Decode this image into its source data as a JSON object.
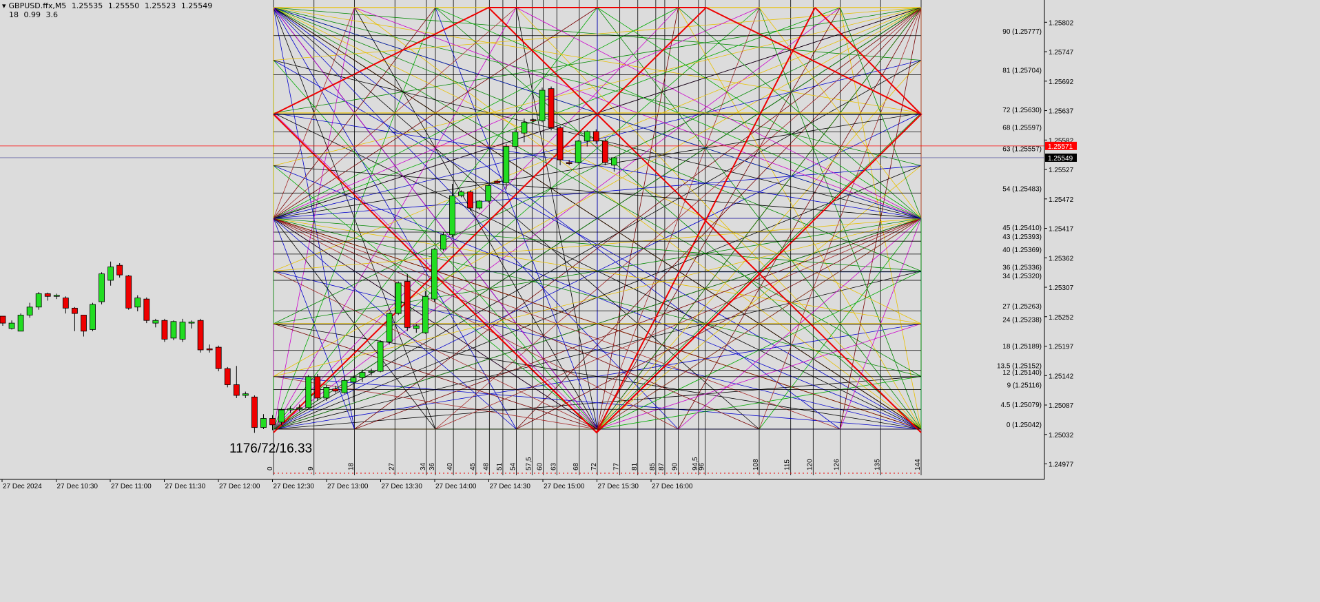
{
  "header": {
    "symbol": "GBPUSD.ffx,M5",
    "open": "1.25535",
    "high": "1.25550",
    "low": "1.25523",
    "close": "1.25549",
    "ind1": "18",
    "ind2": "0.99",
    "ind3": "3.6"
  },
  "annotation": "1176/72/16.33",
  "chart_data": {
    "type": "candlestick",
    "symbol": "GBPUSD.ffx",
    "timeframe": "M5",
    "grid": true,
    "ylim": [
      1.2495,
      1.2585
    ],
    "y_ticks": [
      "1.25802",
      "1.25747",
      "1.25692",
      "1.25637",
      "1.25582",
      "1.25527",
      "1.25472",
      "1.25417",
      "1.25362",
      "1.25307",
      "1.25252",
      "1.25197",
      "1.25142",
      "1.25087",
      "1.25032",
      "1.24977"
    ],
    "x_ticks": [
      "27 Dec 2024",
      "27 Dec 10:30",
      "27 Dec 11:00",
      "27 Dec 11:30",
      "27 Dec 12:00",
      "27 Dec 12:30",
      "27 Dec 13:00",
      "27 Dec 13:30",
      "27 Dec 14:00",
      "27 Dec 14:30",
      "27 Dec 15:00",
      "27 Dec 15:30",
      "27 Dec 16:00"
    ],
    "price_labels": {
      "bid": "1.25571",
      "ask": "1.25549",
      "bid_color": "#ff0000",
      "ask_color": "#000000"
    },
    "levels": [
      {
        "label": "90 (1.25777)",
        "price": 1.25777
      },
      {
        "label": "81 (1.25704)",
        "price": 1.25704
      },
      {
        "label": "72 (1.25630)",
        "price": 1.2563
      },
      {
        "label": "68 (1.25597)",
        "price": 1.25597
      },
      {
        "label": "63 (1.25557)",
        "price": 1.25557
      },
      {
        "label": "54 (1.25483)",
        "price": 1.25483
      },
      {
        "label": "45 (1.25410)",
        "price": 1.2541
      },
      {
        "label": "43 (1.25393)",
        "price": 1.25393
      },
      {
        "label": "40 (1.25369)",
        "price": 1.25369
      },
      {
        "label": "36 (1.25336)",
        "price": 1.25336
      },
      {
        "label": "34 (1.25320)",
        "price": 1.2532
      },
      {
        "label": "27 (1.25263)",
        "price": 1.25263
      },
      {
        "label": "24 (1.25238)",
        "price": 1.25238
      },
      {
        "label": "18 (1.25189)",
        "price": 1.25189
      },
      {
        "label": "13.5 (1.25152)",
        "price": 1.25152
      },
      {
        "label": "12 (1.25140)",
        "price": 1.2514
      },
      {
        "label": "9 (1.25116)",
        "price": 1.25116
      },
      {
        "label": "4.5 (1.25079)",
        "price": 1.25079
      },
      {
        "label": "0 (1.25042)",
        "price": 1.25042
      }
    ],
    "time_divisions": [
      "0",
      "9",
      "18",
      "27",
      "34",
      "36",
      "40",
      "45",
      "48",
      "51",
      "54",
      "57,5",
      "60",
      "63",
      "68",
      "72",
      "77",
      "81",
      "85",
      "87",
      "90",
      "94,5",
      "96",
      "108",
      "115",
      "120",
      "126",
      "135",
      "144"
    ],
    "time_division_index": [
      0,
      9,
      18,
      27,
      34,
      36,
      40,
      45,
      48,
      51,
      54,
      57.5,
      60,
      63,
      68,
      72,
      77,
      81,
      85,
      87,
      90,
      94.5,
      96,
      108,
      115,
      120,
      126,
      135,
      144
    ],
    "candles_ohlc": [
      [
        1.25253,
        1.25253,
        1.25235,
        1.2524
      ],
      [
        1.2523,
        1.25245,
        1.25228,
        1.2524
      ],
      [
        1.25225,
        1.25258,
        1.25225,
        1.25255
      ],
      [
        1.25255,
        1.25278,
        1.2525,
        1.2527
      ],
      [
        1.2527,
        1.25298,
        1.25265,
        1.25295
      ],
      [
        1.25295,
        1.25297,
        1.25282,
        1.2529
      ],
      [
        1.2529,
        1.25295,
        1.25285,
        1.25292
      ],
      [
        1.25287,
        1.2529,
        1.25258,
        1.25268
      ],
      [
        1.25268,
        1.2527,
        1.25225,
        1.25258
      ],
      [
        1.25255,
        1.25255,
        1.25215,
        1.25225
      ],
      [
        1.25228,
        1.25278,
        1.25225,
        1.25275
      ],
      [
        1.2528,
        1.25335,
        1.25275,
        1.25332
      ],
      [
        1.2532,
        1.25355,
        1.2531,
        1.25345
      ],
      [
        1.25348,
        1.25352,
        1.25325,
        1.2533
      ],
      [
        1.25328,
        1.2533,
        1.25265,
        1.25268
      ],
      [
        1.2527,
        1.25292,
        1.25262,
        1.25287
      ],
      [
        1.25285,
        1.25288,
        1.2524,
        1.25245
      ],
      [
        1.2524,
        1.25248,
        1.25232,
        1.25245
      ],
      [
        1.25245,
        1.25248,
        1.25205,
        1.2521
      ],
      [
        1.25212,
        1.25245,
        1.25208,
        1.25243
      ],
      [
        1.2521,
        1.25248,
        1.25205,
        1.25242
      ],
      [
        1.2524,
        1.25245,
        1.2523,
        1.25242
      ],
      [
        1.25245,
        1.25248,
        1.25185,
        1.2519
      ],
      [
        1.25192,
        1.252,
        1.25185,
        1.2519
      ],
      [
        1.25195,
        1.25198,
        1.2515,
        1.25155
      ],
      [
        1.25155,
        1.25158,
        1.2512,
        1.25125
      ],
      [
        1.25125,
        1.2516,
        1.251,
        1.25105
      ],
      [
        1.25105,
        1.25112,
        1.251,
        1.25108
      ],
      [
        1.25102,
        1.25105,
        1.25035,
        1.25045
      ],
      [
        1.25045,
        1.2507,
        1.25042,
        1.25062
      ],
      [
        1.25062,
        1.25068,
        1.2504,
        1.2505
      ],
      [
        1.25055,
        1.2508,
        1.2505,
        1.25078
      ],
      [
        1.25078,
        1.25085,
        1.25072,
        1.2508
      ],
      [
        1.2508,
        1.25088,
        1.25075,
        1.25082
      ],
      [
        1.25082,
        1.25143,
        1.2508,
        1.2514
      ],
      [
        1.2514,
        1.25145,
        1.25095,
        1.251
      ],
      [
        1.251,
        1.25125,
        1.25095,
        1.2512
      ],
      [
        1.25117,
        1.25123,
        1.2511,
        1.25113
      ],
      [
        1.2511,
        1.2514,
        1.25108,
        1.25133
      ],
      [
        1.2513,
        1.25142,
        1.25093,
        1.25138
      ],
      [
        1.25138,
        1.25153,
        1.2513,
        1.25148
      ],
      [
        1.25148,
        1.25155,
        1.25142,
        1.2515
      ],
      [
        1.2515,
        1.25208,
        1.25148,
        1.25205
      ],
      [
        1.25205,
        1.2526,
        1.252,
        1.25258
      ],
      [
        1.25258,
        1.25318,
        1.25255,
        1.25315
      ],
      [
        1.25318,
        1.25332,
        1.25225,
        1.25232
      ],
      [
        1.2523,
        1.25238,
        1.25222,
        1.25235
      ],
      [
        1.25222,
        1.253,
        1.2522,
        1.2529
      ],
      [
        1.25285,
        1.2538,
        1.2528,
        1.25378
      ],
      [
        1.25378,
        1.2541,
        1.25375,
        1.25405
      ],
      [
        1.25405,
        1.255,
        1.254,
        1.25478
      ],
      [
        1.25478,
        1.25488,
        1.25475,
        1.25485
      ],
      [
        1.25485,
        1.25488,
        1.2545,
        1.25455
      ],
      [
        1.25455,
        1.2547,
        1.25452,
        1.25468
      ],
      [
        1.25468,
        1.255,
        1.25465,
        1.25497
      ],
      [
        1.25505,
        1.25508,
        1.255,
        1.25502
      ],
      [
        1.25502,
        1.25575,
        1.2549,
        1.2557
      ],
      [
        1.2557,
        1.25602,
        1.25565,
        1.25597
      ],
      [
        1.25595,
        1.25622,
        1.25578,
        1.25615
      ],
      [
        1.2562,
        1.25622,
        1.25615,
        1.25618
      ],
      [
        1.25618,
        1.2568,
        1.25615,
        1.25675
      ],
      [
        1.25678,
        1.25682,
        1.256,
        1.25605
      ],
      [
        1.25605,
        1.25608,
        1.25535,
        1.25545
      ],
      [
        1.2554,
        1.25545,
        1.25535,
        1.25538
      ],
      [
        1.2554,
        1.25582,
        1.25538,
        1.2558
      ],
      [
        1.2558,
        1.256,
        1.2557,
        1.25598
      ],
      [
        1.25598,
        1.25602,
        1.25575,
        1.2558
      ],
      [
        1.2558,
        1.25585,
        1.25535,
        1.2554
      ],
      [
        1.25535,
        1.2555,
        1.25523,
        1.25549
      ]
    ]
  }
}
